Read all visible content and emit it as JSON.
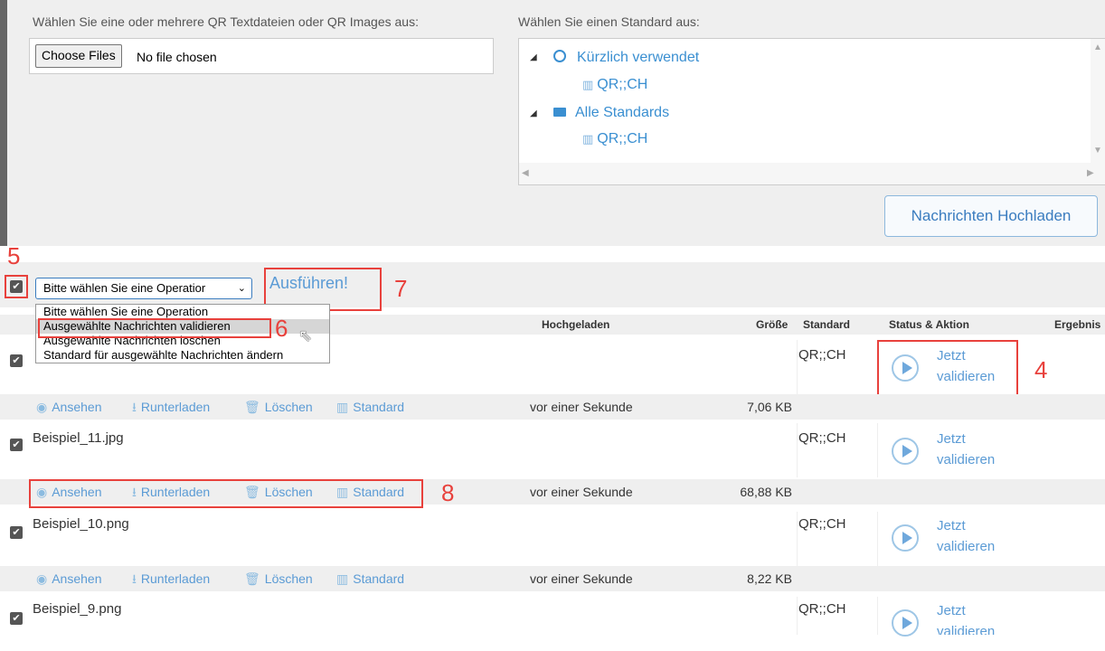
{
  "upload": {
    "file_label": "Wählen Sie eine oder mehrere QR Textdateien oder QR Images aus:",
    "choose_files": "Choose Files",
    "no_file": "No file chosen",
    "standard_label": "Wählen Sie einen Standard aus:",
    "tree": {
      "recent": "Kürzlich verwendet",
      "recent_child": "QR;;CH",
      "all": "Alle Standards",
      "all_child": "QR;;CH"
    },
    "upload_button": "Nachrichten Hochladen"
  },
  "operations": {
    "selected": "Bitte wählen Sie eine Operatior",
    "options": [
      "Bitte wählen Sie eine Operation",
      "Ausgewählte Nachrichten validieren",
      "Ausgewählte Nachrichten löschen",
      "Standard für ausgewählte Nachrichten ändern"
    ],
    "execute": "Ausführen!"
  },
  "table": {
    "headers": {
      "uploaded": "Hochgeladen",
      "size": "Größe",
      "standard": "Standard",
      "status": "Status & Aktion",
      "result": "Ergebnis"
    },
    "actions": {
      "view": "Ansehen",
      "download": "Runterladen",
      "delete": "Löschen",
      "standard": "Standard"
    },
    "validate_line1": "Jetzt",
    "validate_line2": "validieren",
    "rows": [
      {
        "name": "",
        "standard": "QR;;CH",
        "uploaded": "vor einer Sekunde",
        "size": "7,06 KB"
      },
      {
        "name": "Beispiel_11.jpg",
        "standard": "QR;;CH",
        "uploaded": "vor einer Sekunde",
        "size": "68,88 KB"
      },
      {
        "name": "Beispiel_10.png",
        "standard": "QR;;CH",
        "uploaded": "vor einer Sekunde",
        "size": "8,22 KB"
      },
      {
        "name": "Beispiel_9.png",
        "standard": "QR;;CH"
      }
    ]
  },
  "annotations": {
    "n4": "4",
    "n5": "5",
    "n6": "6",
    "n7": "7",
    "n8": "8"
  },
  "icons": {
    "clock": "clock-icon",
    "map": "map-icon",
    "folder": "folder-icon",
    "eye": "eye-icon",
    "download": "download-icon",
    "trash": "trash-icon",
    "play": "play-icon"
  },
  "colors": {
    "accent": "#5b9bd5",
    "annotation": "#e8413c"
  }
}
